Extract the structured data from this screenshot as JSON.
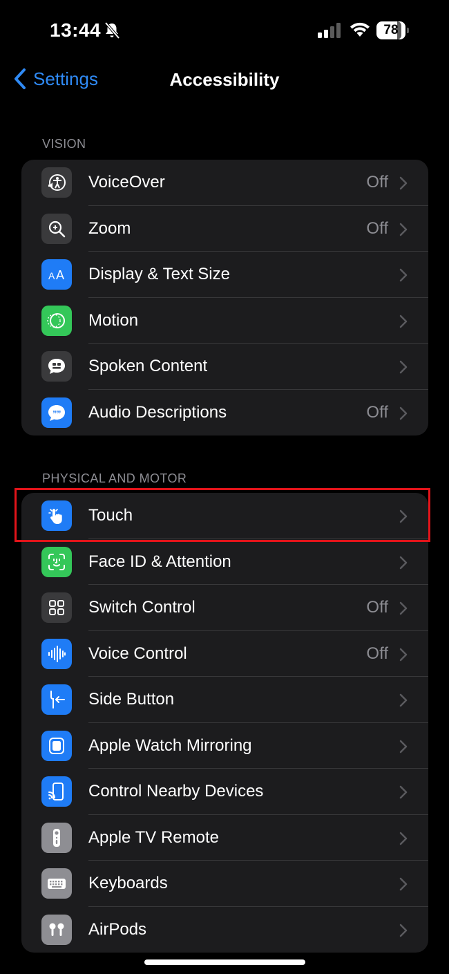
{
  "status_bar": {
    "time": "13:44",
    "battery": "78"
  },
  "nav": {
    "back_label": "Settings",
    "title": "Accessibility"
  },
  "sections": [
    {
      "header": "VISION",
      "rows": [
        {
          "name": "voiceover",
          "label": "VoiceOver",
          "value": "Off",
          "icon": "voiceover-icon",
          "icon_bg": "#3a3a3c"
        },
        {
          "name": "zoom",
          "label": "Zoom",
          "value": "Off",
          "icon": "zoom-icon",
          "icon_bg": "#3a3a3c"
        },
        {
          "name": "display-text-size",
          "label": "Display & Text Size",
          "value": "",
          "icon": "text-size-icon",
          "icon_bg": "#1f7cf6"
        },
        {
          "name": "motion",
          "label": "Motion",
          "value": "",
          "icon": "motion-icon",
          "icon_bg": "#34c759"
        },
        {
          "name": "spoken-content",
          "label": "Spoken Content",
          "value": "",
          "icon": "spoken-content-icon",
          "icon_bg": "#3a3a3c"
        },
        {
          "name": "audio-descriptions",
          "label": "Audio Descriptions",
          "value": "Off",
          "icon": "audio-descriptions-icon",
          "icon_bg": "#1f7cf6"
        }
      ]
    },
    {
      "header": "PHYSICAL AND MOTOR",
      "rows": [
        {
          "name": "touch",
          "label": "Touch",
          "value": "",
          "icon": "touch-hand-icon",
          "icon_bg": "#1f7cf6"
        },
        {
          "name": "face-id-attention",
          "label": "Face ID & Attention",
          "value": "",
          "icon": "face-id-icon",
          "icon_bg": "#34c759"
        },
        {
          "name": "switch-control",
          "label": "Switch Control",
          "value": "Off",
          "icon": "switch-control-icon",
          "icon_bg": "#3a3a3c"
        },
        {
          "name": "voice-control",
          "label": "Voice Control",
          "value": "Off",
          "icon": "voice-control-icon",
          "icon_bg": "#1f7cf6"
        },
        {
          "name": "side-button",
          "label": "Side Button",
          "value": "",
          "icon": "side-button-icon",
          "icon_bg": "#1f7cf6"
        },
        {
          "name": "apple-watch-mirroring",
          "label": "Apple Watch Mirroring",
          "value": "",
          "icon": "watch-mirroring-icon",
          "icon_bg": "#1f7cf6"
        },
        {
          "name": "control-nearby-devices",
          "label": "Control Nearby Devices",
          "value": "",
          "icon": "nearby-devices-icon",
          "icon_bg": "#1f7cf6"
        },
        {
          "name": "apple-tv-remote",
          "label": "Apple TV Remote",
          "value": "",
          "icon": "tv-remote-icon",
          "icon_bg": "#8e8e93"
        },
        {
          "name": "keyboards",
          "label": "Keyboards",
          "value": "",
          "icon": "keyboard-icon",
          "icon_bg": "#8e8e93"
        },
        {
          "name": "airpods",
          "label": "AirPods",
          "value": "",
          "icon": "airpods-icon",
          "icon_bg": "#8e8e93"
        }
      ]
    }
  ],
  "colors": {
    "accent": "#2f8af5",
    "highlight": "#e3141a",
    "cell_bg": "#1c1c1e"
  }
}
